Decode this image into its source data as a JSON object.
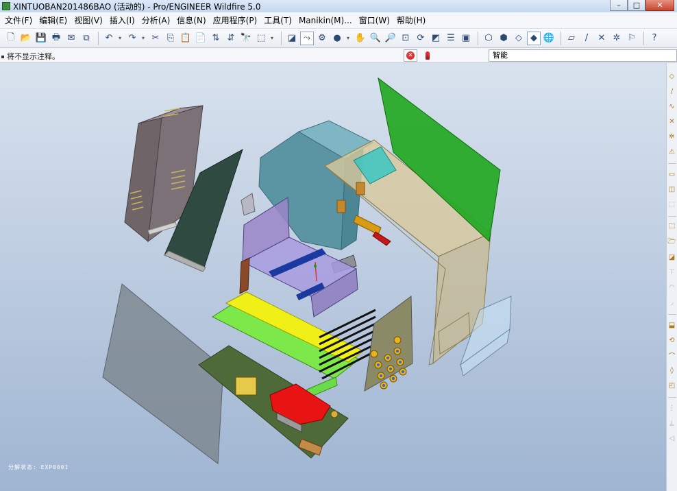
{
  "window": {
    "title": "XINTUOBAN201486BAO (活动的) - Pro/ENGINEER Wildfire 5.0",
    "controls": {
      "minimize": "–",
      "maximize": "□",
      "close": "✕"
    }
  },
  "menubar": {
    "items": [
      "文件(F)",
      "编辑(E)",
      "视图(V)",
      "插入(I)",
      "分析(A)",
      "信息(N)",
      "应用程序(P)",
      "工具(T)",
      "Manikin(M)...",
      "窗口(W)",
      "帮助(H)"
    ]
  },
  "toolbar": {
    "buttons": [
      {
        "name": "new-icon",
        "glyph": "🗋"
      },
      {
        "name": "open-icon",
        "glyph": "📂"
      },
      {
        "name": "save-icon",
        "glyph": "💾"
      },
      {
        "name": "print-icon",
        "glyph": "🖶"
      },
      {
        "name": "send-mail-icon",
        "glyph": "✉"
      },
      {
        "name": "close-window-icon",
        "glyph": "⧉"
      },
      {
        "sep": true
      },
      {
        "name": "undo-icon",
        "glyph": "↶",
        "dropdown": true
      },
      {
        "name": "redo-icon",
        "glyph": "↷",
        "dropdown": true
      },
      {
        "name": "cut-icon",
        "glyph": "✂"
      },
      {
        "name": "copy-icon",
        "glyph": "⎘"
      },
      {
        "name": "paste-icon",
        "glyph": "📋"
      },
      {
        "name": "paste-special-icon",
        "glyph": "📄"
      },
      {
        "name": "regenerate-icon",
        "glyph": "⇅"
      },
      {
        "name": "regen-manager-icon",
        "glyph": "⇵"
      },
      {
        "name": "find-icon",
        "glyph": "🔭"
      },
      {
        "name": "select-box-icon",
        "glyph": "⬚",
        "dropdown": true
      },
      {
        "sep": true
      },
      {
        "name": "repaint-icon",
        "glyph": "◪"
      },
      {
        "name": "spin-center-icon",
        "glyph": "⤳",
        "active": true
      },
      {
        "name": "orient-mode-icon",
        "glyph": "⚙"
      },
      {
        "name": "appearance-icon",
        "glyph": "●",
        "dropdown": true
      },
      {
        "name": "pan-hand-icon",
        "glyph": "✋"
      },
      {
        "name": "zoom-in-icon",
        "glyph": "🔍"
      },
      {
        "name": "zoom-out-icon",
        "glyph": "🔎"
      },
      {
        "name": "refit-icon",
        "glyph": "⊡"
      },
      {
        "name": "reorient-icon",
        "glyph": "⟳"
      },
      {
        "name": "saved-views-icon",
        "glyph": "◩"
      },
      {
        "name": "layers-icon",
        "glyph": "☰"
      },
      {
        "name": "view-manager-icon",
        "glyph": "▣"
      },
      {
        "sep": true
      },
      {
        "name": "wireframe-icon",
        "glyph": "⬡"
      },
      {
        "name": "hidden-line-icon",
        "glyph": "⬢"
      },
      {
        "name": "no-hidden-icon",
        "glyph": "◇"
      },
      {
        "name": "shading-icon",
        "glyph": "◆",
        "active": true
      },
      {
        "name": "enhanced-realism-icon",
        "glyph": "🌐"
      },
      {
        "sep": true
      },
      {
        "name": "datum-plane-display-icon",
        "glyph": "▱"
      },
      {
        "name": "datum-axis-display-icon",
        "glyph": "/"
      },
      {
        "name": "point-display-icon",
        "glyph": "✕"
      },
      {
        "name": "csys-display-icon",
        "glyph": "✲"
      },
      {
        "name": "annotation-display-icon",
        "glyph": "⚐"
      },
      {
        "sep": true
      },
      {
        "name": "context-help-icon",
        "glyph": "?"
      }
    ]
  },
  "statusbar": {
    "note": "将不显示注释。",
    "filter_value": "智能"
  },
  "graphics": {
    "explode_label": "分解状态: EXP0001"
  },
  "right_toolbar": {
    "buttons": [
      {
        "name": "datum-plane-tool-icon",
        "glyph": "◇"
      },
      {
        "name": "datum-axis-tool-icon",
        "glyph": "/"
      },
      {
        "name": "sketched-curve-icon",
        "glyph": "∿"
      },
      {
        "name": "datum-point-icon",
        "glyph": "✕"
      },
      {
        "name": "csys-tool-icon",
        "glyph": "✲"
      },
      {
        "name": "analysis-feature-icon",
        "glyph": "⚠"
      },
      {
        "sep": true
      },
      {
        "name": "add-component-icon",
        "glyph": "▭"
      },
      {
        "name": "create-component-icon",
        "glyph": "◫"
      },
      {
        "name": "repeat-component-icon",
        "glyph": "⬚",
        "faint": true
      },
      {
        "sep": true
      },
      {
        "name": "fold-icon",
        "glyph": "🗀"
      },
      {
        "name": "folder-tool-icon",
        "glyph": "🗁"
      },
      {
        "name": "skeleton-icon",
        "glyph": "◪"
      },
      {
        "name": "cut-feature-icon",
        "glyph": "⊤",
        "faint": true
      },
      {
        "name": "round-icon",
        "glyph": "◠",
        "faint": true
      },
      {
        "name": "chamfer-icon",
        "glyph": "◞",
        "faint": true
      },
      {
        "sep": true
      },
      {
        "name": "extrude-icon",
        "glyph": "⬓"
      },
      {
        "name": "revolve-icon",
        "glyph": "⟲"
      },
      {
        "name": "sweep-icon",
        "glyph": "⌒"
      },
      {
        "name": "blend-icon",
        "glyph": "◊"
      },
      {
        "name": "shell-icon",
        "glyph": "◰"
      },
      {
        "sep": true
      },
      {
        "name": "pattern-icon",
        "glyph": "⋮",
        "faint": true
      },
      {
        "name": "mirror-icon",
        "glyph": "⟂",
        "faint": true
      },
      {
        "name": "trim-icon",
        "glyph": "◁",
        "faint": true
      }
    ]
  }
}
